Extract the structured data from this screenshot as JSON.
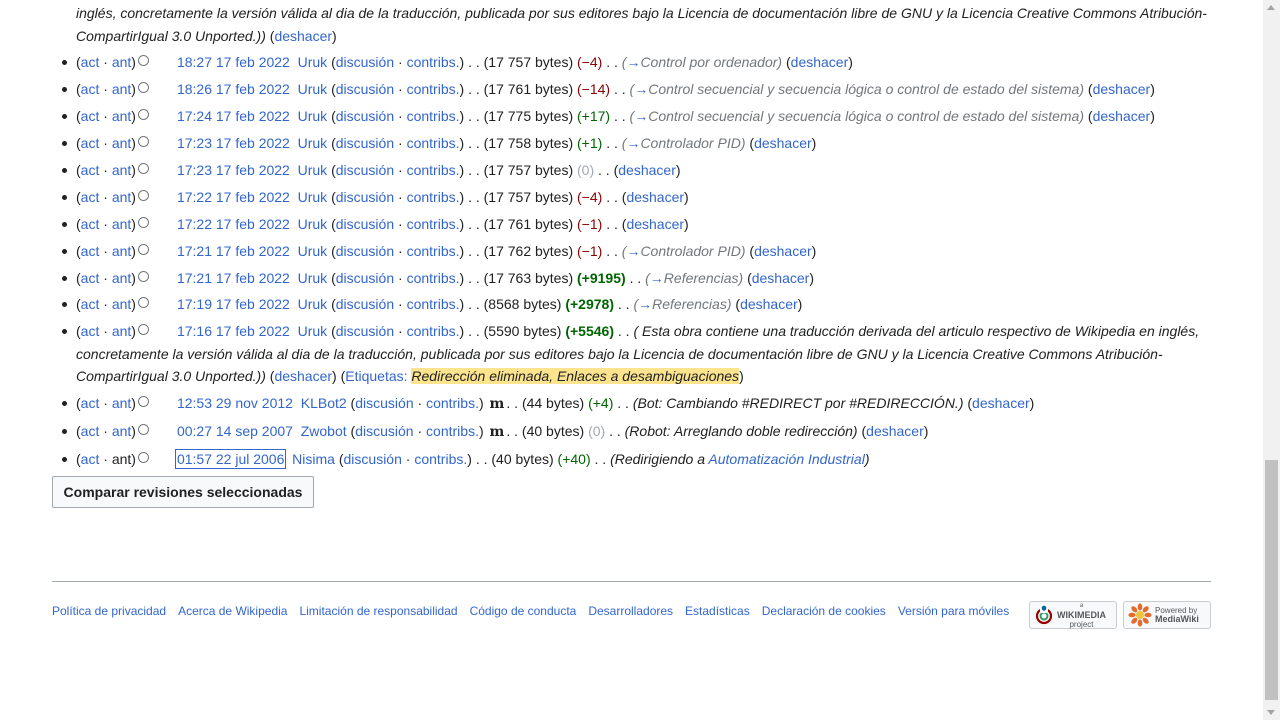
{
  "labels": {
    "act": "act",
    "ant": "ant",
    "discusion": "discusión",
    "contribs": "contribs.",
    "deshacer": "deshacer",
    "etiquetas": "Etiquetas:",
    "dot": "·",
    "arrow": "→",
    "dots": ". .",
    "minor": "m"
  },
  "top_fragment": {
    "text_line1": "inglés, concretamente la versión válida al dia de la traducción, publicada por sus editores bajo la Licencia de documentación libre de GNU y la Licencia Creative Commons Atribución-",
    "text_line2": "CompartirIgual 3.0 Unported.))",
    "undo": "deshacer"
  },
  "revisions": [
    {
      "date": "18:27 17 feb 2022",
      "user": "Uruk",
      "size": "(17 757 bytes)",
      "diff": "(−4)",
      "diff_kind": "neg",
      "section": "Control por ordenador",
      "comment": ""
    },
    {
      "date": "18:26 17 feb 2022",
      "user": "Uruk",
      "size": "(17 761 bytes)",
      "diff": "(−14)",
      "diff_kind": "neg",
      "section": "Control secuencial y secuencia lógica o control de estado del sistema",
      "comment": ""
    },
    {
      "date": "17:24 17 feb 2022",
      "user": "Uruk",
      "size": "(17 775 bytes)",
      "diff": "(+17)",
      "diff_kind": "pos",
      "section": "Control secuencial y secuencia lógica o control de estado del sistema",
      "comment": ""
    },
    {
      "date": "17:23 17 feb 2022",
      "user": "Uruk",
      "size": "(17 758 bytes)",
      "diff": "(+1)",
      "diff_kind": "pos",
      "section": "Controlador PID",
      "comment": ""
    },
    {
      "date": "17:23 17 feb 2022",
      "user": "Uruk",
      "size": "(17 757 bytes)",
      "diff": "(0)",
      "diff_kind": "zero",
      "section": "",
      "comment": ""
    },
    {
      "date": "17:22 17 feb 2022",
      "user": "Uruk",
      "size": "(17 757 bytes)",
      "diff": "(−4)",
      "diff_kind": "neg",
      "section": "",
      "comment": ""
    },
    {
      "date": "17:22 17 feb 2022",
      "user": "Uruk",
      "size": "(17 761 bytes)",
      "diff": "(−1)",
      "diff_kind": "neg",
      "section": "",
      "comment": ""
    },
    {
      "date": "17:21 17 feb 2022",
      "user": "Uruk",
      "size": "(17 762 bytes)",
      "diff": "(−1)",
      "diff_kind": "neg",
      "section": "Controlador PID",
      "comment": ""
    },
    {
      "date": "17:21 17 feb 2022",
      "user": "Uruk",
      "size": "(17 763 bytes)",
      "diff": "(+9195)",
      "diff_kind": "posbold",
      "section": "Referencias",
      "comment": ""
    },
    {
      "date": "17:19 17 feb 2022",
      "user": "Uruk",
      "size": "(8568 bytes)",
      "diff": "(+2978)",
      "diff_kind": "posbold",
      "section": "Referencias",
      "comment": ""
    }
  ],
  "long_revision": {
    "date": "17:16 17 feb 2022",
    "user": "Uruk",
    "size": "(5590 bytes)",
    "diff": "(+5546)",
    "comment_line1": "( Esta obra contiene una traducción derivada del articulo respectivo de Wikipedia en inglés,",
    "comment_line2": "concretamente la versión válida al dia de la traducción, publicada por sus editores bajo la Licencia de documentación libre de GNU y la Licencia Creative Commons Atribución-",
    "comment_line3": "CompartirIgual 3.0 Unported.))",
    "tag1": "Redirección eliminada",
    "tag2": "Enlaces a desambiguaciones"
  },
  "bot_revisions": [
    {
      "date": "12:53 29 nov 2012",
      "user": "KLBot2",
      "size": "(44 bytes)",
      "diff": "(+4)",
      "diff_kind": "pos",
      "comment": "(Bot: Cambiando #REDIRECT por #REDIRECCIÓN.)"
    },
    {
      "date": "00:27 14 sep 2007",
      "user": "Zwobot",
      "size": "(40 bytes)",
      "diff": "(0)",
      "diff_kind": "zero",
      "comment": "(Robot: Arreglando doble redirección)"
    }
  ],
  "first_revision": {
    "date": "01:57 22 jul 2006",
    "user": "Nisima",
    "size": "(40 bytes)",
    "diff": "(+40)",
    "comment_prefix": "(Redirigiendo a ",
    "comment_link": "Automatización Industrial",
    "comment_suffix": ")"
  },
  "compare_button": "Comparar revisiones seleccionadas",
  "footer": {
    "links": [
      "Política de privacidad",
      "Acerca de Wikipedia",
      "Limitación de responsabilidad",
      "Código de conducta",
      "Desarrolladores",
      "Estadísticas",
      "Declaración de cookies",
      "Versión para móviles"
    ],
    "wikimedia_badge": {
      "small": "a",
      "main": "WIKIMEDIA",
      "sub": "project"
    },
    "mediawiki_badge": {
      "small": "Powered by",
      "main": "MediaWiki"
    }
  }
}
